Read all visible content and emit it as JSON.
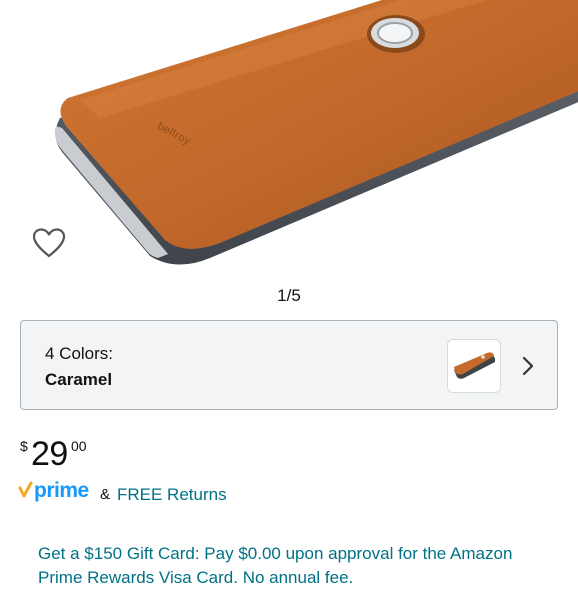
{
  "product_image": {
    "brand_mark": "bellroy",
    "alt": "Caramel leather phone case"
  },
  "gallery": {
    "pager": "1/5",
    "wishlist_icon": "heart-outline-icon"
  },
  "variant": {
    "label": "4 Colors:",
    "selected": "Caramel",
    "chevron_icon": "chevron-right-icon"
  },
  "price": {
    "symbol": "$",
    "whole": "29",
    "fraction": "00"
  },
  "shipping": {
    "prime_text": "prime",
    "ampersand": "&",
    "free_returns": "FREE Returns"
  },
  "promo": {
    "text": "Get a $150 Gift Card: Pay $0.00 upon approval for the Amazon Prime Rewards Visa Card. No annual fee."
  },
  "colors": {
    "link": "#007185",
    "prime_blue": "#1399ff",
    "prime_orange": "#f7a823",
    "case_caramel": "#c56a2a"
  }
}
